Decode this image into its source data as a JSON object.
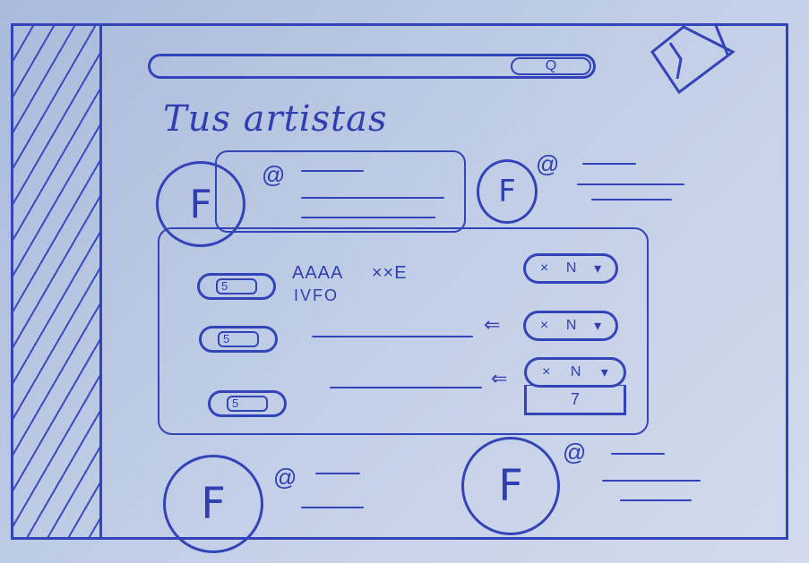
{
  "header": {
    "search": {
      "icon": "search-icon",
      "button_glyph": "Q"
    }
  },
  "page": {
    "title": "Tus artistas"
  },
  "artists": [
    {
      "initial": "F",
      "handle_symbol": "@"
    },
    {
      "initial": "F",
      "handle_symbol": "@"
    },
    {
      "initial": "F",
      "handle_symbol": "@"
    },
    {
      "initial": "F",
      "handle_symbol": "@"
    }
  ],
  "track_panel": {
    "rows": [
      {
        "pill_label": "5",
        "title": "AAAA",
        "title_suffix": "××E",
        "subtitle": "IVFO",
        "control": {
          "remove": "×",
          "sort": "N",
          "dropdown": "▾"
        }
      },
      {
        "pill_label": "5",
        "arrow": "⇐",
        "control": {
          "remove": "×",
          "sort": "N",
          "dropdown": "▾"
        }
      },
      {
        "pill_label": "5",
        "arrow": "⇐",
        "control": {
          "remove": "×",
          "sort": "N",
          "dropdown": "▾"
        },
        "extra_option": "7"
      }
    ]
  },
  "colors": {
    "ink": "#3344b8",
    "paper": "#c4d0e8"
  }
}
